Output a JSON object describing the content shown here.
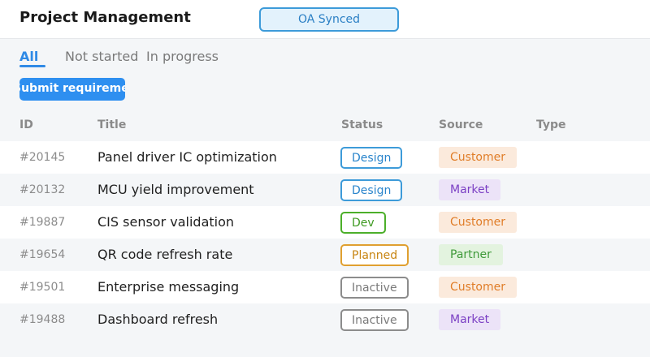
{
  "header": {
    "title": "Project Management",
    "sync_badge": "OA Synced"
  },
  "tabs": [
    {
      "label": "All",
      "active": true
    },
    {
      "label": "Not started",
      "active": false
    },
    {
      "label": "In progress",
      "active": false
    }
  ],
  "submit_button": {
    "label": "Submit requirement"
  },
  "table": {
    "columns": [
      "ID",
      "Title",
      "Status",
      "Source",
      "Type"
    ],
    "rows": [
      {
        "id": "#20145",
        "title": "Panel driver IC optimization",
        "status": "Design",
        "source": "Customer",
        "type": ""
      },
      {
        "id": "#20132",
        "title": "MCU yield improvement",
        "status": "Design",
        "source": "Market",
        "type": ""
      },
      {
        "id": "#19887",
        "title": "CIS sensor validation",
        "status": "Dev",
        "source": "Customer",
        "type": ""
      },
      {
        "id": "#19654",
        "title": "QR code refresh rate",
        "status": "Planned",
        "source": "Partner",
        "type": ""
      },
      {
        "id": "#19501",
        "title": "Enterprise messaging",
        "status": "Inactive",
        "source": "Customer",
        "type": ""
      },
      {
        "id": "#19488",
        "title": "Dashboard refresh",
        "status": "Inactive",
        "source": "Market",
        "type": ""
      }
    ]
  },
  "colors": {
    "accent": "#2f8ae6",
    "status": {
      "Design": {
        "border": "#3d9bd9",
        "text": "#2a85cc"
      },
      "Dev": {
        "border": "#4caf2a",
        "text": "#3f9a22"
      },
      "Planned": {
        "border": "#e0a030",
        "text": "#c88512"
      },
      "Inactive": {
        "border": "#8c8c8c",
        "text": "#7a7a7a"
      }
    },
    "source": {
      "Customer": {
        "bg": "#fbeadc",
        "text": "#e07d28"
      },
      "Market": {
        "bg": "#ece3f8",
        "text": "#7b3fc4"
      },
      "Partner": {
        "bg": "#e3f3df",
        "text": "#3f9a3a"
      }
    }
  }
}
